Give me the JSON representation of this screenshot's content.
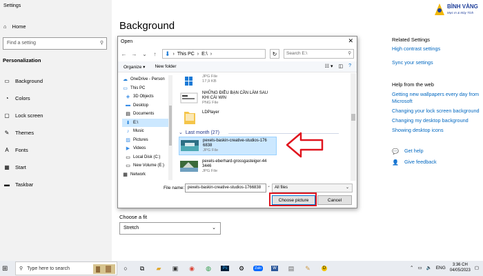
{
  "settings": {
    "window_title": "Settings",
    "home": "Home",
    "search_placeholder": "Find a setting",
    "section": "Personalization",
    "items": [
      "Background",
      "Colors",
      "Lock screen",
      "Themes",
      "Fonts",
      "Start",
      "Taskbar"
    ]
  },
  "main": {
    "title": "Background",
    "fit_label": "Choose a fit",
    "fit_value": "Stretch"
  },
  "related": {
    "heading": "Related Settings",
    "links": [
      "High contrast settings",
      "Sync your settings"
    ],
    "help_heading": "Help from the web",
    "help_links": [
      "Getting new wallpapers every day from Microsoft",
      "Changing your lock screen background",
      "Changing my desktop background",
      "Showing desktop icons"
    ],
    "get_help": "Get help",
    "give_feedback": "Give feedback"
  },
  "logo": {
    "name": "BÌNH VÀNG",
    "tagline": "Mực In & Máy Tính"
  },
  "dialog": {
    "title": "Open",
    "path": [
      "This PC",
      "E:\\"
    ],
    "search_placeholder": "Search E:\\",
    "organize": "Organize",
    "new_folder": "New folder",
    "nav": [
      "OneDrive - Person",
      "This PC",
      "3D Objects",
      "Desktop",
      "Documents",
      "E:\\",
      "Music",
      "Pictures",
      "Videos",
      "Local Disk (C:)",
      "New Volume (E:)",
      "Network"
    ],
    "files_top": [
      {
        "name": "",
        "type": "JPG File",
        "size": "17,9 KB"
      },
      {
        "name": "NHỮNG ĐIỀU BẠN CẦN LÀM SAU KHI CÀI WIN",
        "type": "PNG File"
      },
      {
        "name": "LDPlayer",
        "type": ""
      }
    ],
    "group": "Last month (27)",
    "files_month": [
      {
        "name": "pexels-baskin-creative-studios-176 6838",
        "type": "JPG File"
      },
      {
        "name": "pexels-eberhard-grossgasteiger-44 3446",
        "type": "JPG File"
      }
    ],
    "filename_label": "File name:",
    "filename_value": "pexels-baskin-creative-studios-1766838",
    "filetype": "All files",
    "choose": "Choose picture",
    "cancel": "Cancel"
  },
  "taskbar": {
    "search": "Type here to search",
    "lang": "ENG",
    "time": "3:36 CH",
    "date": "04/05/2023"
  },
  "colors": {
    "accent": "#0067c0",
    "highlight": "#e0141e",
    "selection": "#cce8ff"
  }
}
